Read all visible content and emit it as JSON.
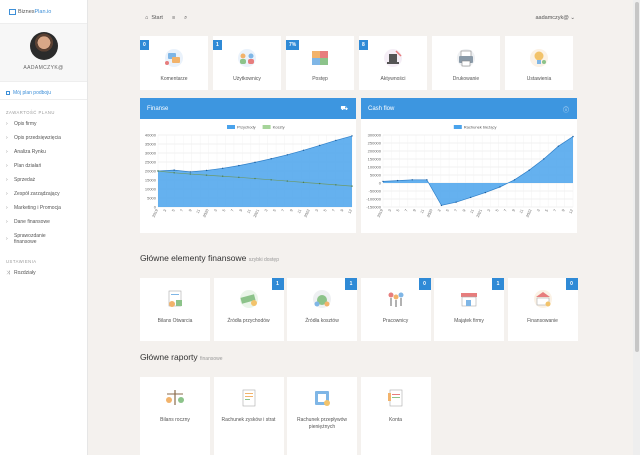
{
  "app": {
    "logo_prefix": "Biznes",
    "logo_suffix": "Plan.io"
  },
  "user": {
    "name": "AADAMCZYK@"
  },
  "sidebar": {
    "my_plan": "Mój plan podboju",
    "section_plan": "ZAWARTOŚĆ PLANU",
    "items": [
      {
        "label": "Opis firmy"
      },
      {
        "label": "Opis przedsięwzięcia"
      },
      {
        "label": "Analiza Rynku"
      },
      {
        "label": "Plan działań"
      },
      {
        "label": "Sprzedaż"
      },
      {
        "label": "Zespół zarządzający"
      },
      {
        "label": "Marketing i Promocja"
      },
      {
        "label": "Dane finansowe"
      },
      {
        "label": "Sprawozdanie finansowe"
      }
    ],
    "section_settings": "USTAWIENIA",
    "settings_items": [
      {
        "label": "Rozdziały"
      }
    ]
  },
  "topbar": {
    "start": "Start",
    "user_menu": "aadamczyk@"
  },
  "tiles": [
    {
      "badge": "0",
      "label": "Komentarze"
    },
    {
      "badge": "1",
      "label": "Użytkownicy"
    },
    {
      "badge": "7%",
      "label": "Postęp"
    },
    {
      "badge": "8",
      "label": "Aktywności"
    },
    {
      "badge": "",
      "label": "Drukowanie"
    },
    {
      "badge": "",
      "label": "Ustawienia"
    }
  ],
  "chart_data": [
    {
      "type": "area",
      "title": "Finanse",
      "series": [
        {
          "name": "Przychody",
          "color": "#4aa3ec",
          "values": [
            20000,
            20500,
            19500,
            20300,
            21500,
            23000,
            24800,
            26800,
            29000,
            31500,
            34200,
            37000,
            39500
          ]
        },
        {
          "name": "Koszty",
          "color": "#a6d49a",
          "values": [
            20000,
            19000,
            18300,
            17700,
            17100,
            16500,
            15800,
            15100,
            14400,
            13700,
            13000,
            12300,
            11600
          ]
        }
      ],
      "x": [
        "2019",
        "3",
        "5",
        "7",
        "9",
        "11",
        "2020",
        "3",
        "5",
        "7",
        "9",
        "11",
        "2021",
        "3",
        "5",
        "7",
        "9",
        "11",
        "2022",
        "3",
        "5",
        "7",
        "9",
        "12"
      ],
      "ylim": [
        0,
        40000
      ],
      "yticks": [
        "0",
        "5000",
        "10000",
        "15000",
        "20000",
        "25000",
        "30000",
        "35000",
        "40000"
      ],
      "legend": "top-center",
      "grid": true
    },
    {
      "type": "area",
      "title": "Cash flow",
      "series": [
        {
          "name": "Rachunek bieżący",
          "color": "#4aa3ec",
          "values": [
            10000,
            15000,
            20000,
            20000,
            -140000,
            -120000,
            -90000,
            -60000,
            -25000,
            20000,
            80000,
            150000,
            230000,
            290000
          ]
        }
      ],
      "x": [
        "2019",
        "3",
        "5",
        "7",
        "9",
        "11",
        "2020",
        "3",
        "5",
        "7",
        "9",
        "11",
        "2021",
        "3",
        "5",
        "7",
        "9",
        "11",
        "2022",
        "3",
        "5",
        "7",
        "9",
        "12"
      ],
      "ylim": [
        -150000,
        300000
      ],
      "yticks": [
        "-150000",
        "-100000",
        "-50000",
        "0",
        "50000",
        "100000",
        "150000",
        "200000",
        "250000",
        "300000"
      ],
      "legend": "top-center",
      "grid": true
    }
  ],
  "financial_elements": {
    "title": "Główne elementy finansowe",
    "subtitle": "szybki dostęp",
    "cards": [
      {
        "label": "Bilans Otwarcia",
        "badge": ""
      },
      {
        "label": "Źródła przychodów",
        "badge": "1"
      },
      {
        "label": "Źródła kosztów",
        "badge": "1"
      },
      {
        "label": "Pracownicy",
        "badge": "0"
      },
      {
        "label": "Majątek firmy",
        "badge": "1"
      },
      {
        "label": "Finansowanie",
        "badge": "0"
      }
    ]
  },
  "financial_reports": {
    "title": "Główne raporty",
    "subtitle": "finansowe",
    "cards": [
      {
        "label": "Bilans roczny"
      },
      {
        "label": "Rachunek zysków i strat"
      },
      {
        "label": "Rachunek przepływów pieniężnych"
      },
      {
        "label": "Konta"
      }
    ]
  }
}
